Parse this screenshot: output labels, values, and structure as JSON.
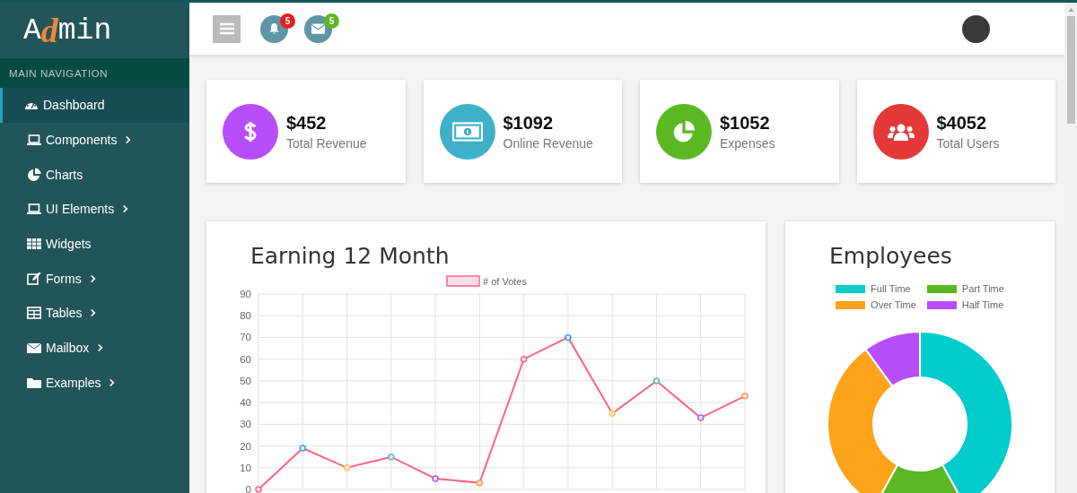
{
  "logo": {
    "lead": "A",
    "accent": "d",
    "rest": "min"
  },
  "sidebar": {
    "heading": "MAIN NAVIGATION",
    "items": [
      {
        "label": "Dashboard",
        "selected": true,
        "expandable": false
      },
      {
        "label": "Components",
        "selected": false,
        "expandable": true
      },
      {
        "label": "Charts",
        "selected": false,
        "expandable": false
      },
      {
        "label": "UI Elements",
        "selected": false,
        "expandable": true
      },
      {
        "label": "Widgets",
        "selected": false,
        "expandable": false
      },
      {
        "label": "Forms",
        "selected": false,
        "expandable": true
      },
      {
        "label": "Tables",
        "selected": false,
        "expandable": true
      },
      {
        "label": "Mailbox",
        "selected": false,
        "expandable": true
      },
      {
        "label": "Examples",
        "selected": false,
        "expandable": true
      }
    ]
  },
  "topbar": {
    "notifications": {
      "count": "5"
    },
    "messages": {
      "count": "5"
    }
  },
  "stats": [
    {
      "value": "$452",
      "label": "Total Revenue",
      "color": "#b84ef9"
    },
    {
      "value": "$1092",
      "label": "Online Revenue",
      "color": "#3eb1c8"
    },
    {
      "value": "$1052",
      "label": "Expenses",
      "color": "#5bb823"
    },
    {
      "value": "$4052",
      "label": "Total Users",
      "color": "#e53939"
    }
  ],
  "earning": {
    "title": "Earning 12 Month",
    "chart_data": {
      "type": "line",
      "grid": true,
      "ylim": [
        0,
        90
      ],
      "yticks": [
        0,
        10,
        20,
        30,
        40,
        50,
        60,
        70,
        80,
        90
      ],
      "series": [
        {
          "name": "# of Votes",
          "color": "#ff6384",
          "marker": true,
          "values": [
            0,
            19,
            10,
            15,
            5,
            3,
            60,
            70,
            35,
            50,
            33,
            43
          ]
        }
      ]
    }
  },
  "employees": {
    "title": "Employees",
    "legend": [
      {
        "label": "Full Time",
        "color": "#00cccc"
      },
      {
        "label": "Part Time",
        "color": "#5bb823"
      },
      {
        "label": "Over Time",
        "color": "#ffa31a"
      },
      {
        "label": "Half Time",
        "color": "#b84ef9"
      }
    ]
  }
}
